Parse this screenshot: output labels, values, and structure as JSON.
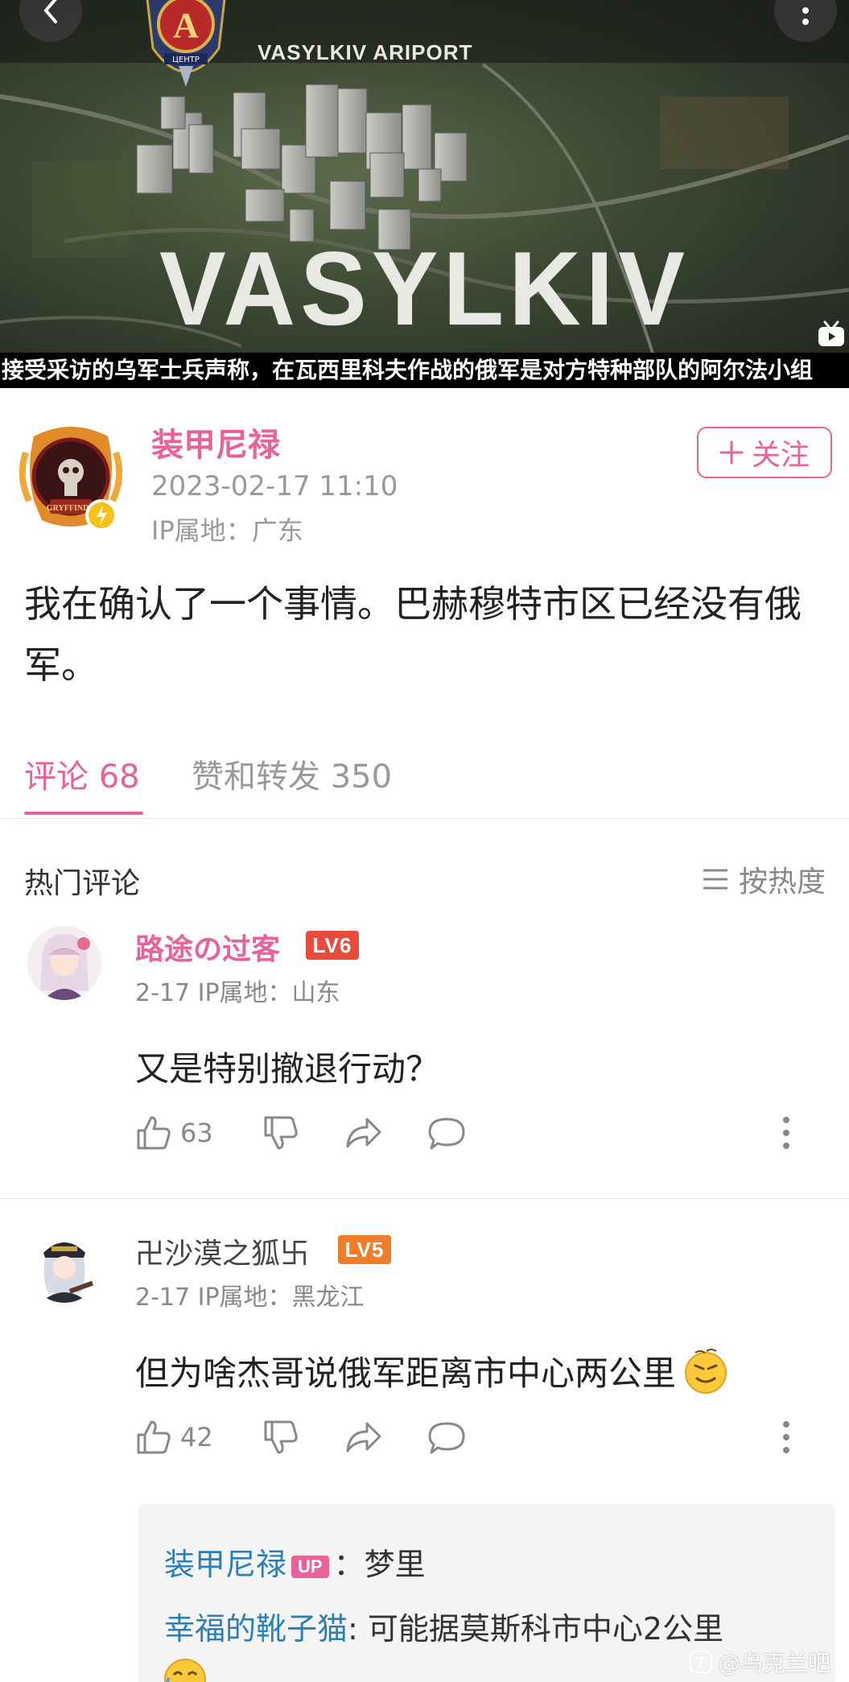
{
  "video": {
    "overlay_label": "VASYLKIV ARIPORT",
    "city_label": "VASYLKIV",
    "emblem_text": "ЦЕНТР",
    "subtitle": "接受采访的乌军士兵声称，在瓦西里科夫作战的俄军是对方特种部队的阿尔法小组"
  },
  "post": {
    "author": "装甲尼禄",
    "timestamp": "2023-02-17 11:10",
    "ip": "IP属地：广东",
    "follow_label": "关注",
    "avatar_text": "GRYFFINDO",
    "text": "我在确认了一个事情。巴赫穆特市区已经没有俄军。"
  },
  "tabs": {
    "comments": "评论 68",
    "likes": "赞和转发 350"
  },
  "section": {
    "hot_title": "热门评论",
    "sort_label": "按热度"
  },
  "comments": [
    {
      "name": "路途の过客",
      "level": "LV6",
      "meta": "2-17 IP属地：山东",
      "text": "又是特别撤退行动？",
      "likes": "63"
    },
    {
      "name": "卍沙漠之狐卐",
      "level": "LV5",
      "meta": "2-17 IP属地：黑龙江",
      "text": "但为啥杰哥说俄军距离市中心两公里",
      "likes": "42"
    }
  ],
  "replies": [
    {
      "name": "装甲尼禄",
      "badge": "UP",
      "text": "：梦里"
    },
    {
      "name": "幸福的靴子猫",
      "text": ": 可能据莫斯科市中心2公里"
    }
  ],
  "watermark": "@乌克兰吧",
  "colors": {
    "accent": "#e8629a",
    "level6": "#e84c3d",
    "level5": "#f07d2a",
    "reply_name": "#2b7fb7"
  }
}
